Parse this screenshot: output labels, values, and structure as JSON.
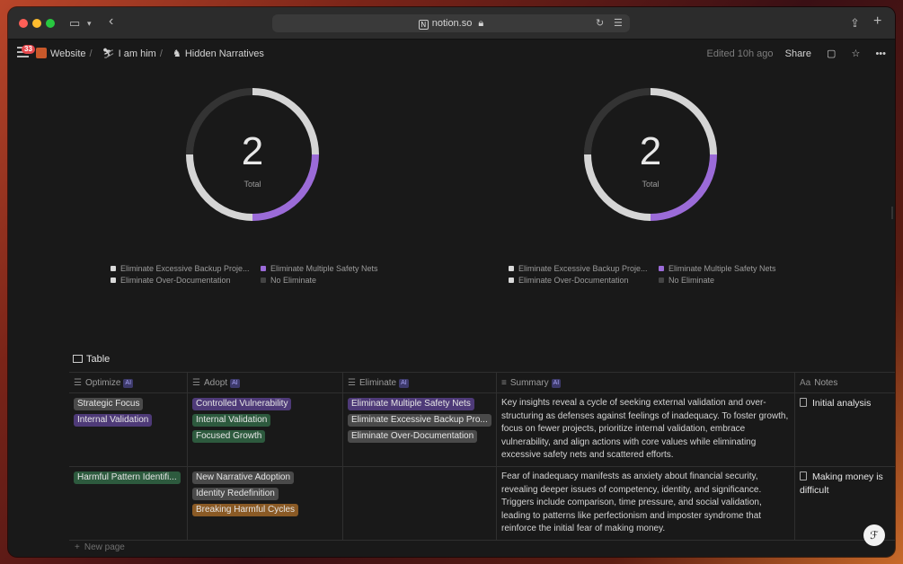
{
  "browser": {
    "url": "notion.so"
  },
  "header": {
    "notification_count": "33",
    "breadcrumbs": [
      "Website",
      "I am him",
      "Hidden Narratives"
    ],
    "edited": "Edited 10h ago",
    "share_label": "Share"
  },
  "charts": [
    {
      "total": "2",
      "total_label": "Total",
      "legend": [
        {
          "label": "Eliminate Excessive Backup Proje...",
          "color": "#d9d9d9"
        },
        {
          "label": "Eliminate Multiple Safety Nets",
          "color": "#9b6bd8"
        },
        {
          "label": "Eliminate Over-Documentation",
          "color": "#d9d9d9"
        },
        {
          "label": "No Eliminate",
          "color": "#444444"
        }
      ]
    },
    {
      "total": "2",
      "total_label": "Total",
      "legend": [
        {
          "label": "Eliminate Excessive Backup Proje...",
          "color": "#d9d9d9"
        },
        {
          "label": "Eliminate Multiple Safety Nets",
          "color": "#9b6bd8"
        },
        {
          "label": "Eliminate Over-Documentation",
          "color": "#d9d9d9"
        },
        {
          "label": "No Eliminate",
          "color": "#444444"
        }
      ]
    }
  ],
  "table": {
    "title": "Table",
    "columns": [
      {
        "label": "Optimize",
        "ai": "AI"
      },
      {
        "label": "Adopt",
        "ai": "AI"
      },
      {
        "label": "Eliminate",
        "ai": "AI"
      },
      {
        "label": "Summary",
        "ai": "AI"
      },
      {
        "label": "Notes",
        "prefix": "Aa"
      }
    ],
    "rows": [
      {
        "optimize": [
          "Strategic Focus",
          "Internal Validation"
        ],
        "adopt": [
          "Controlled Vulnerability",
          "Internal Validation",
          "Focused Growth"
        ],
        "eliminate": [
          "Eliminate Multiple Safety Nets",
          "Eliminate Excessive Backup Pro...",
          "Eliminate Over-Documentation"
        ],
        "summary": "Key insights reveal a cycle of seeking external validation and over-structuring as defenses against feelings of inadequacy. To foster growth, focus on fewer projects, prioritize internal validation, embrace vulnerability, and align actions with core values while eliminating excessive safety nets and scattered efforts.",
        "notes": "Initial analysis"
      },
      {
        "optimize": [
          "Harmful Pattern Identifi..."
        ],
        "adopt": [
          "New Narrative Adoption",
          "Identity Redefinition",
          "Breaking Harmful Cycles"
        ],
        "eliminate": [],
        "summary": "Fear of inadequacy manifests as anxiety about financial security, revealing deeper issues of competency, identity, and significance. Triggers include comparison, time pressure, and social validation, leading to patterns like perfectionism and imposter syndrome that reinforce the initial fear of making money.",
        "notes": "Making money is difficult"
      }
    ],
    "new_page_label": "New page"
  }
}
